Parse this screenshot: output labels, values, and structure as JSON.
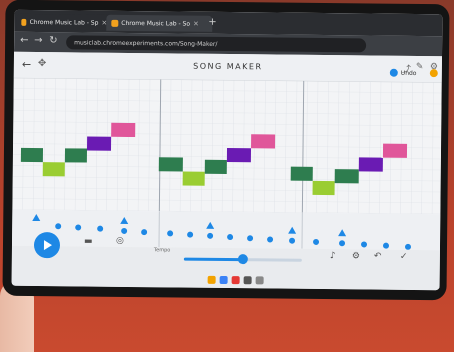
{
  "browser": {
    "tabs": [
      {
        "label": "Chrome Music Lab - Sp"
      },
      {
        "label": "Chrome Music Lab - So"
      }
    ],
    "url": "musiclab.chromeexperiments.com/Song-Maker/"
  },
  "app": {
    "title": "SONG MAKER",
    "undo_label": "Undo",
    "help_label": "?",
    "tempo_label": "Tempo"
  },
  "colors": {
    "accent": "#1e88e5",
    "note_green": "#2e7d4f",
    "note_lime": "#9acd32",
    "note_purple": "#6a1bb3",
    "note_pink": "#e0569a"
  },
  "icons": {
    "play": "play-icon",
    "back": "arrow-left-icon",
    "move": "move-icon"
  }
}
